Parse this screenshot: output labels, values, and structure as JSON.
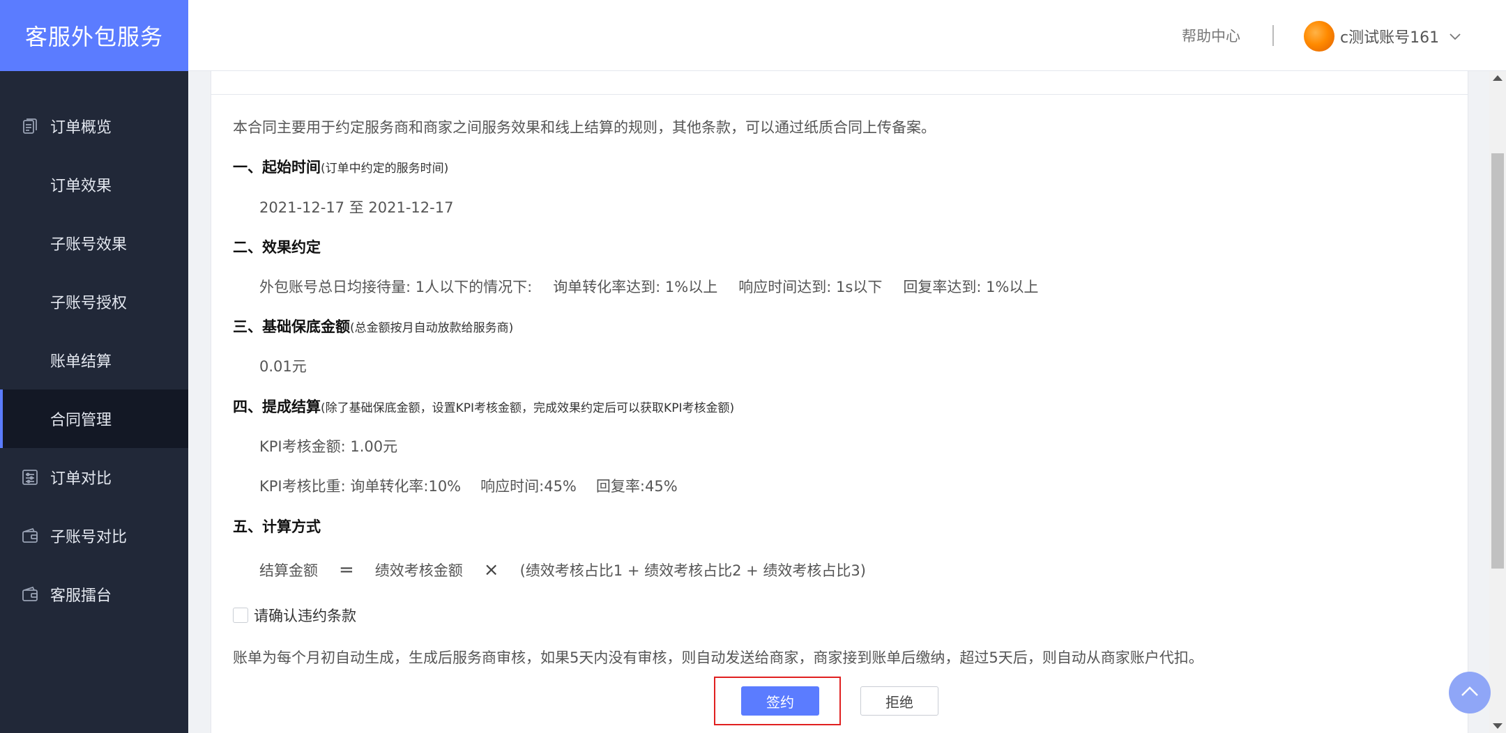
{
  "brand": {
    "title": "客服外包服务"
  },
  "sidebar": {
    "items": [
      {
        "label": "订单概览",
        "icon": "document-icon"
      },
      {
        "label": "订单效果"
      },
      {
        "label": "子账号效果"
      },
      {
        "label": "子账号授权"
      },
      {
        "label": "账单结算"
      },
      {
        "label": "合同管理",
        "active": true
      },
      {
        "label": "订单对比",
        "icon": "sliders-icon"
      },
      {
        "label": "子账号对比",
        "icon": "wallet-icon"
      },
      {
        "label": "客服擂台",
        "icon": "wallet-icon"
      }
    ]
  },
  "header": {
    "help_label": "帮助中心",
    "username": "c测试账号161",
    "caret_icon": "chevron-down-icon"
  },
  "contract": {
    "intro": "本合同主要用于约定服务商和商家之间服务效果和线上结算的规则，其他条款，可以通过纸质合同上传备案。",
    "sec1": {
      "title": "一、起始时间",
      "note": "(订单中约定的服务时间)",
      "value": "2021-12-17 至 2021-12-17"
    },
    "sec2": {
      "title": "二、效果约定",
      "line1": "外包账号总日均接待量: 1人以下的情况下:",
      "line2": "询单转化率达到: 1%以上",
      "line3": "响应时间达到: 1s以下",
      "line4": "回复率达到: 1%以上"
    },
    "sec3": {
      "title": "三、基础保底金额",
      "note": "(总金额按月自动放款给服务商)",
      "value": "0.01元"
    },
    "sec4": {
      "title": "四、提成结算",
      "note": "(除了基础保底金额，设置KPI考核金额，完成效果约定后可以获取KPI考核金额)",
      "kpi_amount": "KPI考核金额: 1.00元",
      "kpi_weight_a": "KPI考核比重: 询单转化率:10%",
      "kpi_weight_b": "响应时间:45%",
      "kpi_weight_c": "回复率:45%"
    },
    "sec5": {
      "title": "五、计算方式",
      "term1": "结算金额",
      "eq": "=",
      "term2": "绩效考核金额",
      "mul": "×",
      "term3": "(绩效考核占比1 + 绩效考核占比2 + 绩效考核占比3)"
    },
    "confirm_label": "请确认违约条款",
    "bottom_note": "账单为每个月初自动生成，生成后服务商审核，如果5天内没有审核，则自动发送给商家，商家接到账单后缴纳，超过5天后，则自动从商家账户代扣。",
    "sign_label": "签约",
    "reject_label": "拒绝"
  },
  "colors": {
    "accent": "#5b7cff",
    "sidebar_bg": "#212838",
    "highlight_frame": "#e02020"
  }
}
